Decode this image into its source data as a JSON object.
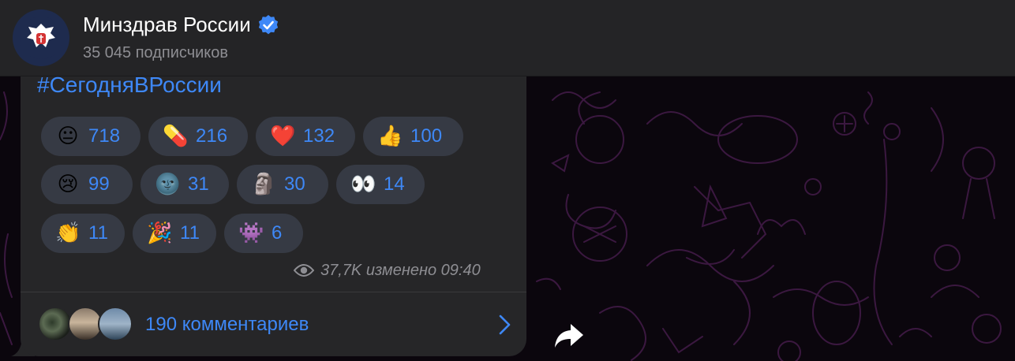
{
  "header": {
    "channel_name": "Минздрав России",
    "subscribers": "35 045 подписчиков",
    "avatar_icon": "coat-of-arms-icon",
    "verified_icon": "verified-badge-icon",
    "colors": {
      "background": "#242426",
      "verified": "#3e88f7"
    }
  },
  "post": {
    "hashtag": "#СегодняВРоссии",
    "reactions": [
      {
        "emoji": "😐",
        "count": "718"
      },
      {
        "emoji": "💊",
        "count": "216"
      },
      {
        "emoji": "❤️",
        "count": "132"
      },
      {
        "emoji": "👍",
        "count": "100"
      },
      {
        "emoji": "😢",
        "count": "99"
      },
      {
        "emoji": "🌚",
        "count": "31"
      },
      {
        "emoji": "🗿",
        "count": "30"
      },
      {
        "emoji": "👀",
        "count": "14"
      },
      {
        "emoji": "👏",
        "count": "11"
      },
      {
        "emoji": "🎉",
        "count": "11"
      },
      {
        "emoji": "👾",
        "count": "6"
      }
    ],
    "views_icon": "eye-icon",
    "meta_text": "37,7K изменено 09:40"
  },
  "comments": {
    "label": "190 комментариев",
    "chevron_icon": "chevron-right-icon"
  },
  "share_icon": "share-arrow-icon",
  "colors": {
    "link": "#3e88f7",
    "bubble": "#262628",
    "reaction_bg": "#363a44",
    "pattern": "#3b1840"
  }
}
